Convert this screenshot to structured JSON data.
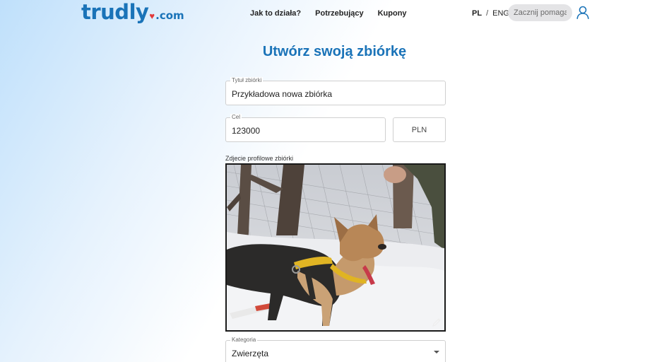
{
  "header": {
    "logo_main": "trudly",
    "logo_heart": "♥",
    "logo_com": ".com",
    "nav": [
      {
        "label": "Jak to działa?"
      },
      {
        "label": "Potrzebujący"
      },
      {
        "label": "Kupony"
      }
    ],
    "lang_pl": "PL",
    "lang_sep": "/",
    "lang_eng": "ENG",
    "search_placeholder": "Zacznij pomagać",
    "user_icon": "user-icon"
  },
  "page": {
    "title": "Utwórz swoją zbiórkę"
  },
  "form": {
    "title_label": "Tytuł zbiórki",
    "title_value": "Przykładowa nowa zbiórka",
    "goal_label": "Cel",
    "goal_value": "123000",
    "currency": "PLN",
    "photo_label": "Zdjecie profilowe zbiórki",
    "photo_edit_icon": "pencil-icon",
    "category_label": "Kategoria",
    "category_value": "Zwierzęta"
  },
  "colors": {
    "brand": "#1a73b8",
    "heart": "#e23a3a"
  }
}
